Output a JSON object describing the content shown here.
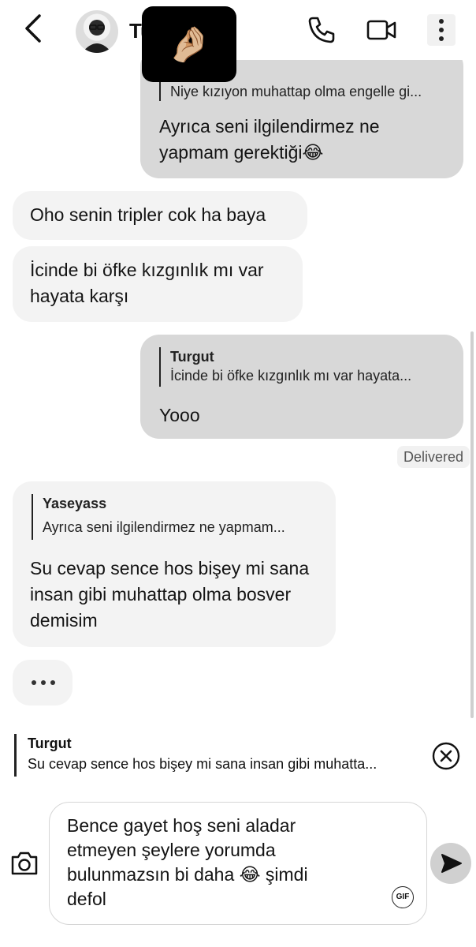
{
  "header": {
    "contact_name": "Tu",
    "sticker": "🤌🏼",
    "icons": [
      "back-arrow-icon",
      "phone-icon",
      "video-camera-icon",
      "more-vertical-icon"
    ]
  },
  "messages": [
    {
      "direction": "outgoing",
      "reply_text": "Niye kızıyon muhattap olma engelle gi...",
      "text": "Ayrıca seni ilgilendirmez ne yapmam gerektiği😂"
    },
    {
      "direction": "incoming",
      "text": "Oho senin tripler cok ha baya"
    },
    {
      "direction": "incoming",
      "text": "İcinde bi öfke kızgınlık mı var hayata karşı"
    },
    {
      "direction": "outgoing",
      "reply_name": "Turgut",
      "reply_text": "İcinde bi öfke kızgınlık mı var hayata...",
      "text": "Yooo"
    },
    {
      "direction": "incoming",
      "reply_name": "Yaseyass",
      "reply_text": "Ayrıca seni ilgilendirmez ne yapmam...",
      "text": "Su cevap sence hos bişey mi sana insan gibi muhattap olma bosver demisim"
    }
  ],
  "status": {
    "delivered": "Delivered"
  },
  "reply_preview": {
    "name": "Turgut",
    "text": "Su cevap sence hos bişey mi sana insan gibi muhatta..."
  },
  "composer": {
    "text": "Bence gayet hoş seni aladar\netmeyen şeylere yorumda\nbulunmazsın bi daha 😂 şimdi\ndefol",
    "gif_label": "GIF"
  },
  "colors": {
    "outgoing_bubble": "#d8d8d8",
    "incoming_bubble": "#f3f3f3",
    "send_button": "#d0d0d0"
  }
}
